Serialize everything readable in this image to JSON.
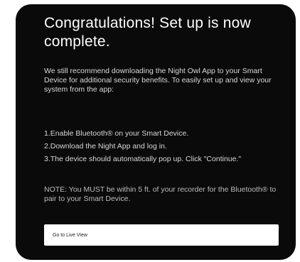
{
  "dialog": {
    "title": "Congratulations! Set up is now complete.",
    "intro": "We still recommend downloading the Night Owl App to your Smart Device for additional security benefits. To easily set up and view your system from the app:",
    "steps": [
      "1.Enable Bluetooth® on your Smart Device.",
      "2.Download the Night App and log in.",
      "3.The device should automatically pop up. Click \"Continue.\""
    ],
    "note": "NOTE: You MUST be within 5 ft. of your recorder for the Bluetooth® to pair to your Smart Device.",
    "live_view_button": "Go to Live View"
  },
  "colors": {
    "background": "#0a0a0a",
    "title_text": "#ffffff",
    "body_text": "#d8d8d8",
    "button_bg": "#ffffff"
  }
}
